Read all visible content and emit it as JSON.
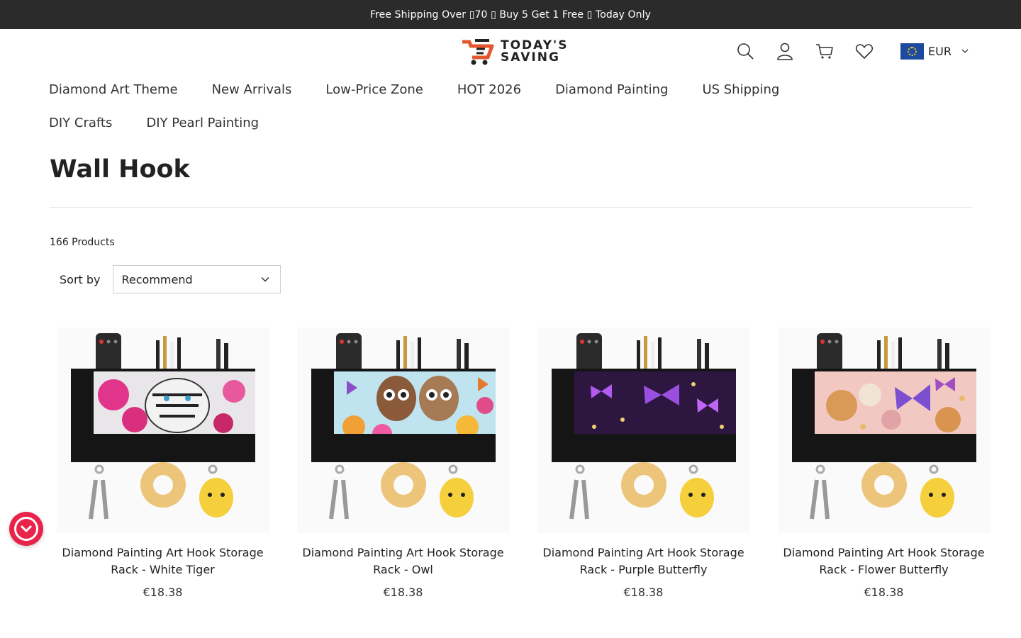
{
  "announcement": "Free Shipping Over ▯70 ▯ Buy 5 Get 1 Free ▯ Today Only",
  "logo": {
    "line1": "TODAY'S",
    "line2": "SAVING"
  },
  "header_icons": [
    "search-icon",
    "account-icon",
    "cart-icon",
    "wishlist-icon"
  ],
  "currency": {
    "label": "EUR",
    "flag": "eu-flag"
  },
  "nav": [
    "Diamond Art Theme",
    "New Arrivals",
    "Low-Price Zone",
    "HOT 2026",
    "Diamond Painting",
    "US Shipping",
    "DIY Crafts",
    "DIY Pearl Painting"
  ],
  "page": {
    "title": "Wall Hook",
    "product_count": "166 Products",
    "sort_label": "Sort by",
    "sort_value": "Recommend"
  },
  "products": [
    {
      "title": "Diamond Painting Art Hook Storage Rack - White Tiger",
      "price": "€18.38",
      "theme": "white tiger with pink flowers"
    },
    {
      "title": "Diamond Painting Art Hook Storage Rack - Owl",
      "price": "€18.38",
      "theme": "owls with colorful flowers"
    },
    {
      "title": "Diamond Painting Art Hook Storage Rack - Purple Butterfly",
      "price": "€18.38",
      "theme": "purple butterflies and moon"
    },
    {
      "title": "Diamond Painting Art Hook Storage Rack - Flower Butterfly",
      "price": "€18.38",
      "theme": "pink flowers and butterflies"
    }
  ],
  "colors": {
    "announcement_bg": "#2b2b2b",
    "logo_accent": "#e4572e",
    "fab": "#e8244b"
  }
}
